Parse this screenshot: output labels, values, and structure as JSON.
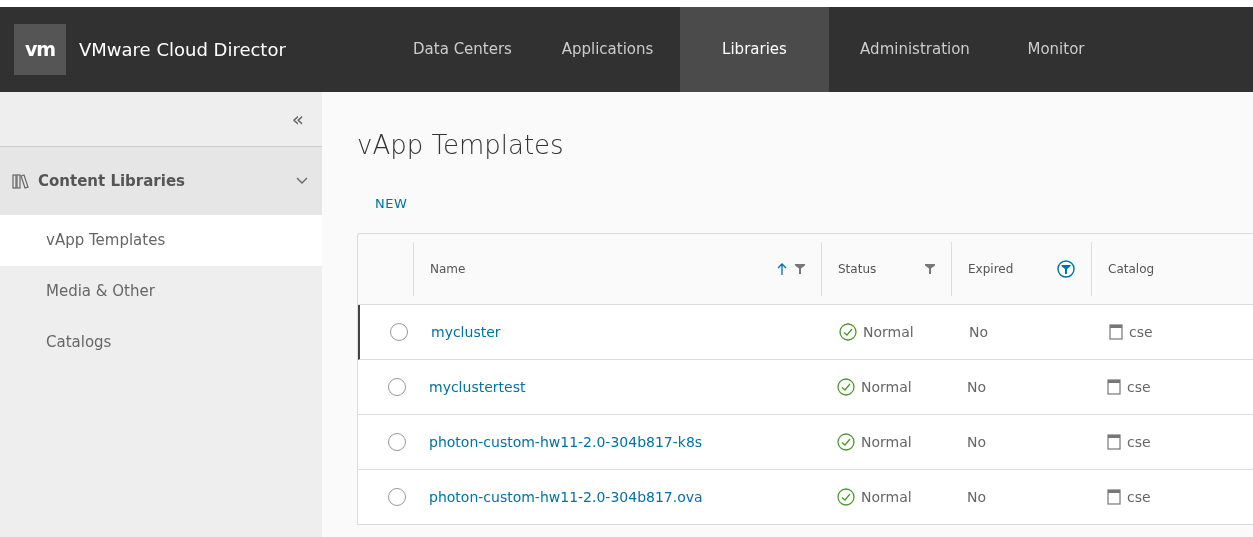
{
  "header": {
    "logo": "vm",
    "product": "VMware Cloud Director",
    "nav": [
      {
        "label": "Data Centers",
        "selected": false
      },
      {
        "label": "Applications",
        "selected": false
      },
      {
        "label": "Libraries",
        "selected": true
      },
      {
        "label": "Administration",
        "selected": false
      },
      {
        "label": "Monitor",
        "selected": false
      }
    ]
  },
  "sidebar": {
    "collapse": "«",
    "group": {
      "label": "Content Libraries",
      "expanded": true,
      "items": [
        {
          "label": "vApp Templates",
          "selected": true
        },
        {
          "label": "Media & Other",
          "selected": false
        },
        {
          "label": "Catalogs",
          "selected": false
        }
      ]
    }
  },
  "page": {
    "title": "vApp Templates",
    "new_button": "NEW"
  },
  "table": {
    "columns": [
      {
        "label": "Name",
        "sorted": true,
        "filter_active": false
      },
      {
        "label": "Status",
        "sorted": false,
        "filter_active": false
      },
      {
        "label": "Expired",
        "sorted": false,
        "filter_active": true
      },
      {
        "label": "Catalog",
        "sorted": false
      }
    ],
    "rows": [
      {
        "selected": false,
        "name": "mycluster",
        "status": "Normal",
        "expired": "No",
        "catalog": "cse"
      },
      {
        "selected": false,
        "name": "myclustertest",
        "status": "Normal",
        "expired": "No",
        "catalog": "cse"
      },
      {
        "selected": false,
        "name": "photon-custom-hw11-2.0-304b817-k8s",
        "status": "Normal",
        "expired": "No",
        "catalog": "cse"
      },
      {
        "selected": false,
        "name": "photon-custom-hw11-2.0-304b817.ova",
        "status": "Normal",
        "expired": "No",
        "catalog": "cse"
      }
    ]
  }
}
